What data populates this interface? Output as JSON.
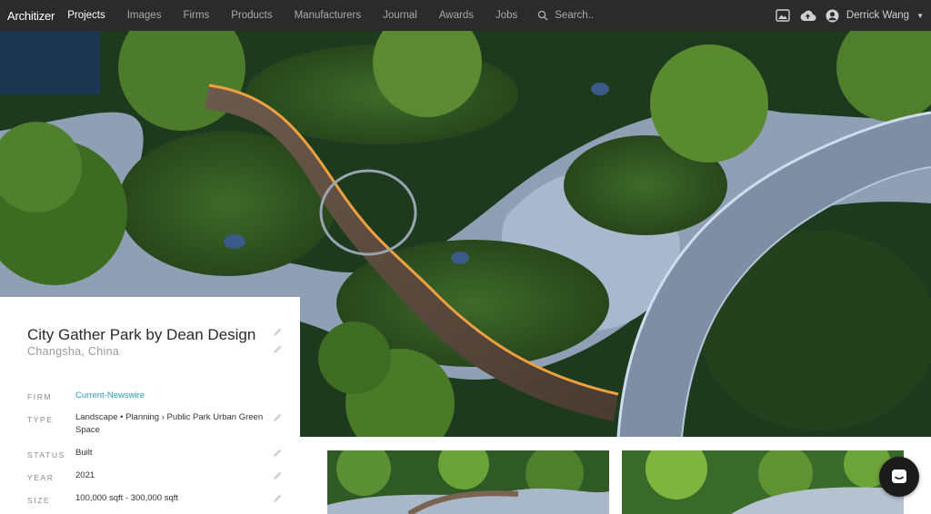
{
  "header": {
    "logo": "Architizer",
    "nav": [
      {
        "label": "Projects",
        "active": true
      },
      {
        "label": "Images",
        "active": false
      },
      {
        "label": "Firms",
        "active": false
      },
      {
        "label": "Products",
        "active": false
      },
      {
        "label": "Manufacturers",
        "active": false
      },
      {
        "label": "Journal",
        "active": false
      },
      {
        "label": "Awards",
        "active": false
      },
      {
        "label": "Jobs",
        "active": false
      }
    ],
    "search_placeholder": "Search..",
    "user_name": "Derrick Wang",
    "icons": [
      "image-icon",
      "upload-cloud-icon",
      "user-avatar-icon",
      "caret-down-icon"
    ]
  },
  "project": {
    "title": "City Gather Park by Dean Design",
    "location": "Changsha, China",
    "details": [
      {
        "label": "FIRM",
        "value": "Current-Newswire",
        "link": true
      },
      {
        "label": "TYPE",
        "value": "Landscape • Planning › Public Park Urban Green Space",
        "link": false
      },
      {
        "label": "STATUS",
        "value": "Built",
        "link": false
      },
      {
        "label": "YEAR",
        "value": "2021",
        "link": false
      },
      {
        "label": "SIZE",
        "value": "100,000 sqft - 300,000 sqft",
        "link": false
      }
    ]
  },
  "colors": {
    "header_bg": "#2b2b2b",
    "nav_active": "#ffffff",
    "nav_inactive": "#a9a9a9",
    "link": "#2a9bb8",
    "chat_button": "#1b1b1b"
  },
  "chat": {
    "icon": "chat-bubble-icon"
  }
}
